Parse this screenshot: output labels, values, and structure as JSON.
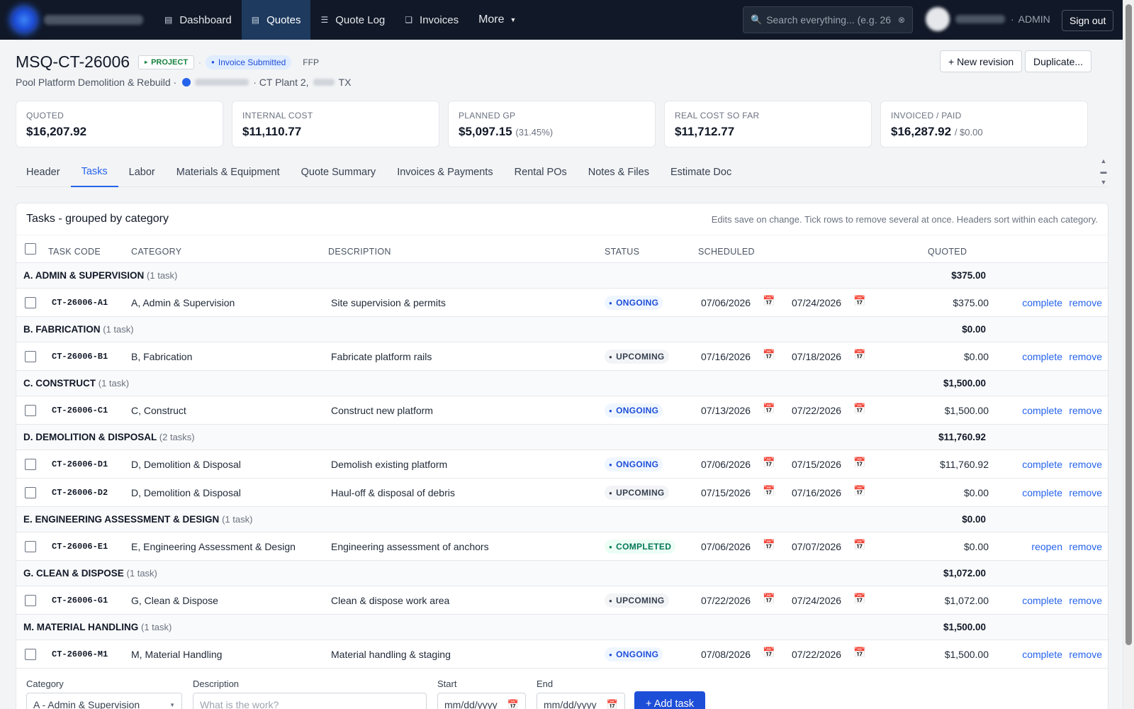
{
  "nav": {
    "items": [
      {
        "label": "Dashboard",
        "icon": "dashboard-icon"
      },
      {
        "label": "Quotes",
        "icon": "quotes-icon"
      },
      {
        "label": "Quote Log",
        "icon": "list-icon"
      },
      {
        "label": "Invoices",
        "icon": "invoice-icon"
      }
    ],
    "more_label": "More",
    "search_placeholder": "Search everything... (e.g. 26",
    "role": "ADMIN",
    "signout_label": "Sign out"
  },
  "page": {
    "title": "MSQ-CT-26006",
    "badge_project": "PROJECT",
    "badge_status": "Invoice Submitted",
    "badge_contract": "FFP",
    "subtitle_project": "Pool Platform Demolition & Rebuild ·",
    "subtitle_site": "· CT Plant 2,",
    "subtitle_state": "TX",
    "btn_new_revision": "+ New revision",
    "btn_duplicate": "Duplicate..."
  },
  "kpis": [
    {
      "label": "QUOTED",
      "value": "$16,207.92",
      "sub": ""
    },
    {
      "label": "INTERNAL COST",
      "value": "$11,110.77",
      "sub": ""
    },
    {
      "label": "PLANNED GP",
      "value": "$5,097.15",
      "sub": "(31.45%)"
    },
    {
      "label": "REAL COST SO FAR",
      "value": "$11,712.77",
      "sub": ""
    },
    {
      "label": "INVOICED / PAID",
      "value": "$16,287.92",
      "sub": "/ $0.00"
    }
  ],
  "tabs": [
    "Header",
    "Tasks",
    "Labor",
    "Materials & Equipment",
    "Quote Summary",
    "Invoices & Payments",
    "Rental POs",
    "Notes & Files",
    "Estimate Doc"
  ],
  "tasks": {
    "title": "Tasks - grouped by category",
    "hint": "Edits save on change. Tick rows to remove several at once. Headers sort within each category.",
    "columns": {
      "code": "TASK CODE",
      "category": "CATEGORY",
      "description": "DESCRIPTION",
      "status": "STATUS",
      "scheduled": "SCHEDULED",
      "quoted": "QUOTED"
    },
    "groups": [
      {
        "name": "A. ADMIN & SUPERVISION",
        "count": "(1 task)",
        "total": "$375.00",
        "rows": [
          {
            "code": "CT-26006-A1",
            "category": "A, Admin & Supervision",
            "description": "Site supervision & permits",
            "status": "ONGOING",
            "start": "07/06/2026",
            "end": "07/24/2026",
            "amount": "$375.00",
            "action": "complete",
            "remove": "remove"
          }
        ]
      },
      {
        "name": "B. FABRICATION",
        "count": "(1 task)",
        "total": "$0.00",
        "rows": [
          {
            "code": "CT-26006-B1",
            "category": "B, Fabrication",
            "description": "Fabricate platform rails",
            "status": "UPCOMING",
            "start": "07/16/2026",
            "end": "07/18/2026",
            "amount": "$0.00",
            "action": "complete",
            "remove": "remove"
          }
        ]
      },
      {
        "name": "C. CONSTRUCT",
        "count": "(1 task)",
        "total": "$1,500.00",
        "rows": [
          {
            "code": "CT-26006-C1",
            "category": "C, Construct",
            "description": "Construct new platform",
            "status": "ONGOING",
            "start": "07/13/2026",
            "end": "07/22/2026",
            "amount": "$1,500.00",
            "action": "complete",
            "remove": "remove"
          }
        ]
      },
      {
        "name": "D. DEMOLITION & DISPOSAL",
        "count": "(2 tasks)",
        "total": "$11,760.92",
        "rows": [
          {
            "code": "CT-26006-D1",
            "category": "D, Demolition & Disposal",
            "description": "Demolish existing platform",
            "status": "ONGOING",
            "start": "07/06/2026",
            "end": "07/15/2026",
            "amount": "$11,760.92",
            "action": "complete",
            "remove": "remove"
          },
          {
            "code": "CT-26006-D2",
            "category": "D, Demolition & Disposal",
            "description": "Haul-off & disposal of debris",
            "status": "UPCOMING",
            "start": "07/15/2026",
            "end": "07/16/2026",
            "amount": "$0.00",
            "action": "complete",
            "remove": "remove"
          }
        ]
      },
      {
        "name": "E. ENGINEERING ASSESSMENT & DESIGN",
        "count": "(1 task)",
        "total": "$0.00",
        "rows": [
          {
            "code": "CT-26006-E1",
            "category": "E, Engineering Assessment & Design",
            "description": "Engineering assessment of anchors",
            "status": "COMPLETED",
            "start": "07/06/2026",
            "end": "07/07/2026",
            "amount": "$0.00",
            "action": "reopen",
            "remove": "remove"
          }
        ]
      },
      {
        "name": "G. CLEAN & DISPOSE",
        "count": "(1 task)",
        "total": "$1,072.00",
        "rows": [
          {
            "code": "CT-26006-G1",
            "category": "G, Clean & Dispose",
            "description": "Clean & dispose work area",
            "status": "UPCOMING",
            "start": "07/22/2026",
            "end": "07/24/2026",
            "amount": "$1,072.00",
            "action": "complete",
            "remove": "remove"
          }
        ]
      },
      {
        "name": "M. MATERIAL HANDLING",
        "count": "(1 task)",
        "total": "$1,500.00",
        "rows": [
          {
            "code": "CT-26006-M1",
            "category": "M, Material Handling",
            "description": "Material handling & staging",
            "status": "ONGOING",
            "start": "07/08/2026",
            "end": "07/22/2026",
            "amount": "$1,500.00",
            "action": "complete",
            "remove": "remove"
          }
        ]
      }
    ],
    "add_form": {
      "category_label": "Category",
      "category_value": "A - Admin & Supervision",
      "description_label": "Description",
      "description_placeholder": "What is the work?",
      "start_label": "Start",
      "start_placeholder": "mm/dd/yyyy",
      "end_label": "End",
      "end_placeholder": "mm/dd/yyyy",
      "add_label": "+ Add task"
    }
  },
  "colors": {
    "nav_bg": "#111827",
    "accent": "#2563eb",
    "ongoing": "#1d4ed8",
    "completed": "#047857"
  }
}
